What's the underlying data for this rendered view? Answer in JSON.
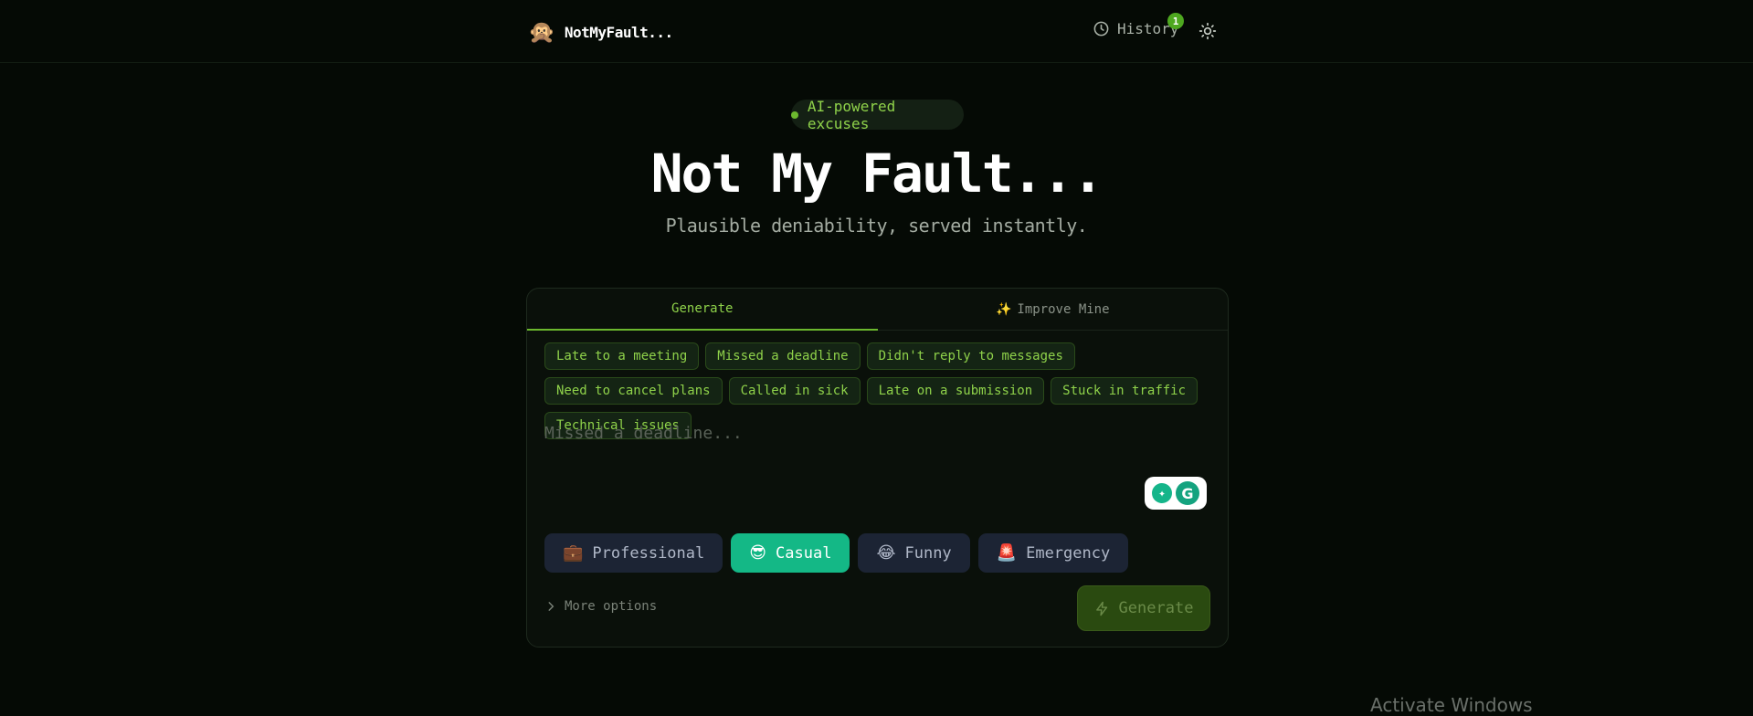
{
  "header": {
    "brand_logo": "🙊",
    "brand_name": "NotMyFault...",
    "history_label": "History",
    "history_badge": "1"
  },
  "hero": {
    "pill_label": "AI-powered excuses",
    "title": "Not My Fault...",
    "subtitle": "Plausible deniability, served instantly."
  },
  "tabs": [
    {
      "label": "Generate",
      "icon": ""
    },
    {
      "label": "Improve Mine",
      "icon": "✨"
    }
  ],
  "chips": [
    "Late to a meeting",
    "Missed a deadline",
    "Didn't reply to messages",
    "Need to cancel plans",
    "Called in sick",
    "Late on a submission",
    "Stuck in traffic",
    "Technical issues"
  ],
  "input": {
    "placeholder": "Missed a deadline...",
    "value": ""
  },
  "tones": [
    {
      "emoji": "💼",
      "label": "Professional",
      "selected": false
    },
    {
      "emoji": "😎",
      "label": "Casual",
      "selected": true
    },
    {
      "emoji": "😂",
      "label": "Funny",
      "selected": false
    },
    {
      "emoji": "🚨",
      "label": "Emergency",
      "selected": false
    }
  ],
  "more_options_label": "More options",
  "generate_button_label": "Generate",
  "peek_text": "Activate Windows",
  "colors": {
    "accent_green": "#6cb82e",
    "tone_active": "#14b886",
    "background": "#050a05"
  }
}
